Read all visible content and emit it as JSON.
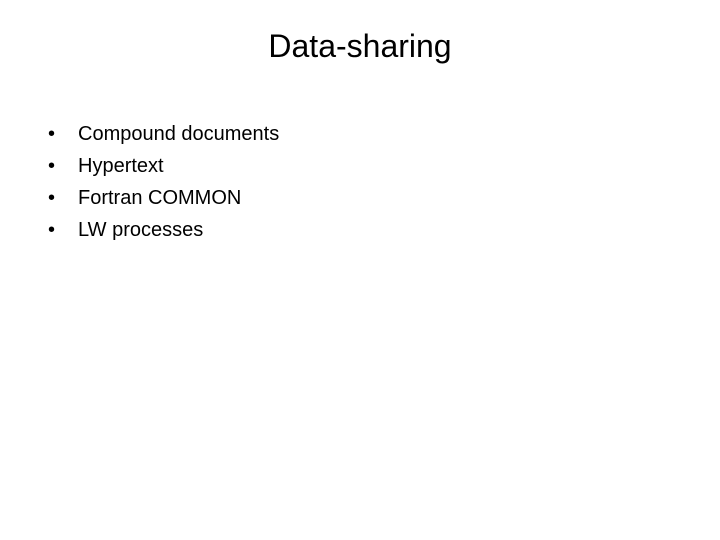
{
  "title": "Data-sharing",
  "bullets": [
    "Compound documents",
    "Hypertext",
    "Fortran COMMON",
    "LW processes"
  ],
  "bullet_marker": "•"
}
